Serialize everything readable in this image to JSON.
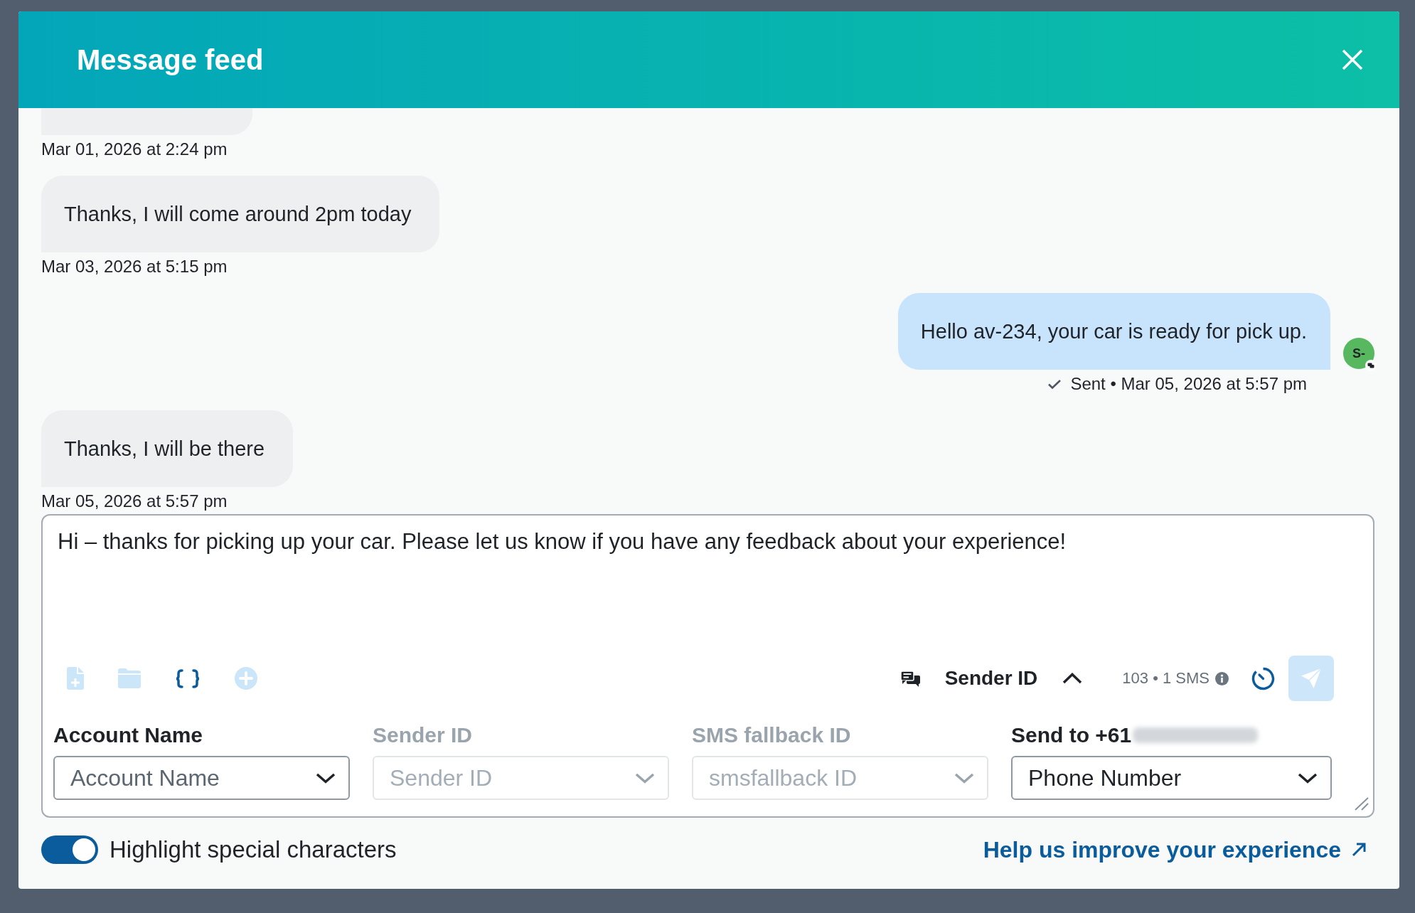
{
  "window": {
    "title": "Message feed"
  },
  "messages": [
    {
      "kind": "received",
      "time": "Mar 01, 2026 at 2:24 pm"
    },
    {
      "kind": "received",
      "text": "Thanks, I will come around 2pm today",
      "time": "Mar 03, 2026 at 5:15 pm"
    },
    {
      "kind": "sent",
      "text": "Hello av-234, your car is ready for pick up.",
      "delivered": true,
      "time": "Sent • Mar 05, 2026 at 5:57 pm",
      "avatar": "S-"
    },
    {
      "kind": "received",
      "text": "Thanks, I will be there",
      "time": "Mar 05, 2026 at 5:57 pm"
    }
  ],
  "composer": {
    "value": "Hi – thanks for picking up your car. Please let us know if you have any feedback about your experience!",
    "tools": [
      {
        "kind": "file-plus",
        "disabled": true
      },
      {
        "kind": "folder",
        "disabled": true
      },
      {
        "kind": "braces",
        "disabled": false
      },
      {
        "kind": "plus-circle",
        "disabled": true
      }
    ],
    "sender_id": {
      "label": "Sender ID",
      "expanded": true
    },
    "counter": "103 • 1 SMS",
    "send_button": {
      "disabled": true
    },
    "fields": [
      {
        "label": "Account Name",
        "placeholder": "Account Name",
        "disabled": false
      },
      {
        "label": "Sender ID",
        "placeholder": "Sender ID",
        "disabled": true
      },
      {
        "label": "SMS fallback ID",
        "placeholder": "smsfallback ID",
        "disabled": true
      },
      {
        "label": "Send to +61",
        "value": "Phone Number",
        "disabled": false,
        "redacted_suffix": true
      }
    ]
  },
  "highlight": {
    "label": "Highlight special characters",
    "on": true
  },
  "help_link": {
    "label": "Help us improve your experience"
  }
}
